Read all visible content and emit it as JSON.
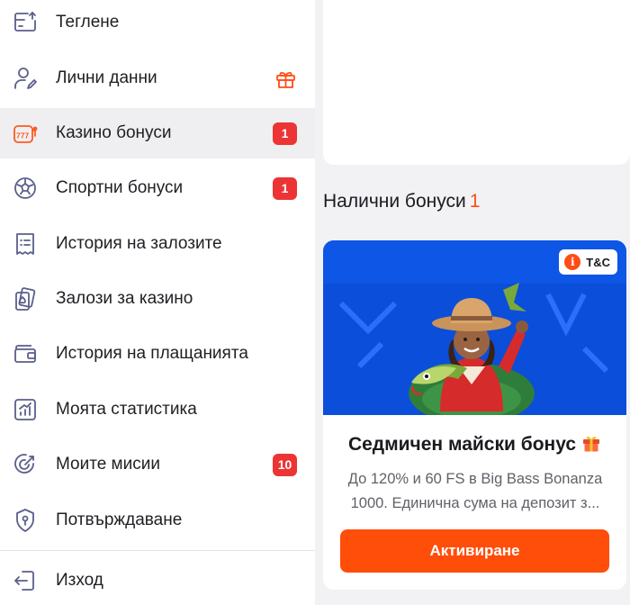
{
  "sidebar": {
    "items": [
      {
        "label": "Теглене",
        "icon": "withdraw-icon"
      },
      {
        "label": "Лични данни",
        "icon": "user-edit-icon",
        "extra_icon": "gift-icon"
      },
      {
        "label": "Казино бонуси",
        "icon": "slot-777-icon",
        "badge": "1",
        "active": true
      },
      {
        "label": "Спортни бонуси",
        "icon": "soccer-ball-icon",
        "badge": "1"
      },
      {
        "label": "История на залозите",
        "icon": "receipt-icon"
      },
      {
        "label": "Залози за казино",
        "icon": "playing-cards-icon"
      },
      {
        "label": "История на плащанията",
        "icon": "wallet-icon"
      },
      {
        "label": "Моята статистика",
        "icon": "chart-icon"
      },
      {
        "label": "Моите мисии",
        "icon": "target-icon",
        "badge": "10"
      },
      {
        "label": "Потвърждаване",
        "icon": "shield-key-icon"
      },
      {
        "label": "Изход",
        "icon": "logout-icon"
      }
    ]
  },
  "main": {
    "section_title": "Налични бонуси",
    "section_count": "1",
    "bonus": {
      "tc_label": "T&C",
      "tc_icon_text": "i",
      "title": "Седмичен майски бонус",
      "description_line1": "До 120% и 60 FS в Big Bass Bonanza",
      "description_line2": "1000. Единична сума на депозит з...",
      "button_label": "Активиране"
    }
  },
  "colors": {
    "accent": "#ff4d0a",
    "badge": "#ec3434",
    "banner": "#0d56e6",
    "active_row": "#efeff2"
  }
}
